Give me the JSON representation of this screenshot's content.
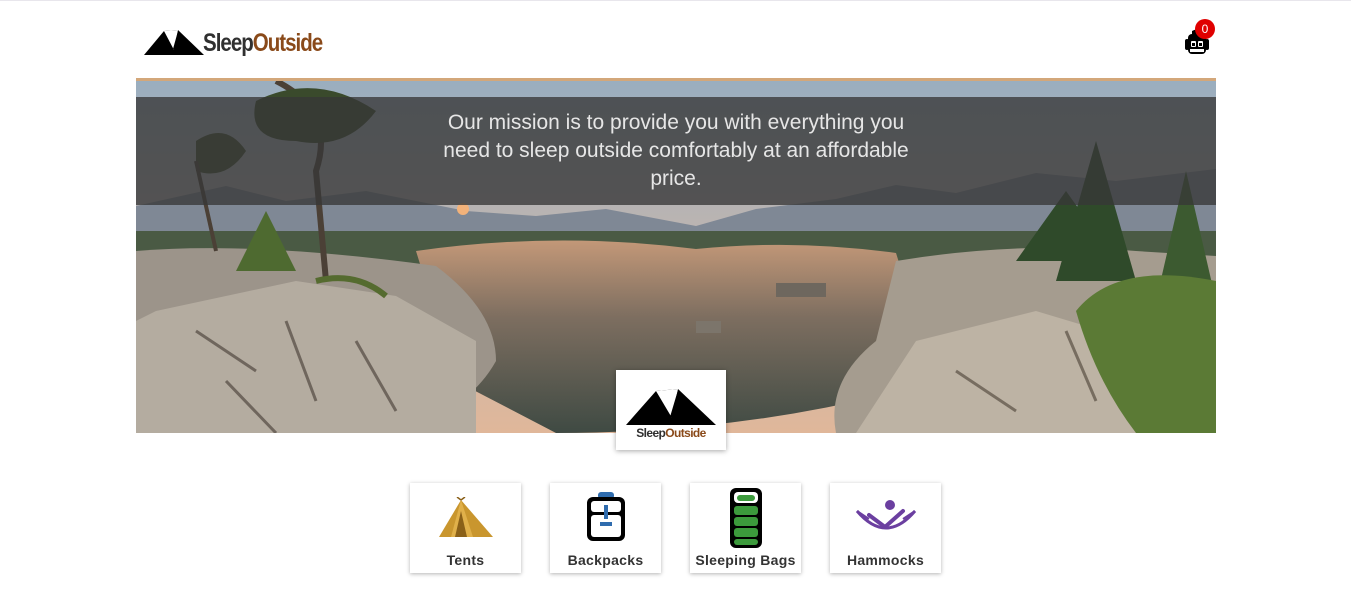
{
  "header": {
    "logo_part1": "Sleep",
    "logo_part2": "Outside",
    "logo_icon": "tent-logo-icon",
    "cart_icon": "backpack-cart-icon",
    "cart_count": "0"
  },
  "hero": {
    "mission_text": "Our mission is to provide you with everything you need to sleep outside comfortably at an affordable price.",
    "badge_part1": "Sleep",
    "badge_part2": "Outside"
  },
  "categories": [
    {
      "label": "Tents",
      "icon": "tent-icon",
      "color": "#c9962e"
    },
    {
      "label": "Backpacks",
      "icon": "backpack-icon",
      "color": "#2f6cae"
    },
    {
      "label": "Sleeping Bags",
      "icon": "sleeping-bag-icon",
      "color": "#3c9a3c"
    },
    {
      "label": "Hammocks",
      "icon": "hammock-icon",
      "color": "#6b3fa0"
    }
  ],
  "colors": {
    "brand_dark": "#303030",
    "brand_accent": "#8a4a1a",
    "hero_border": "#d3a77a",
    "cart_badge": "#e00000"
  }
}
